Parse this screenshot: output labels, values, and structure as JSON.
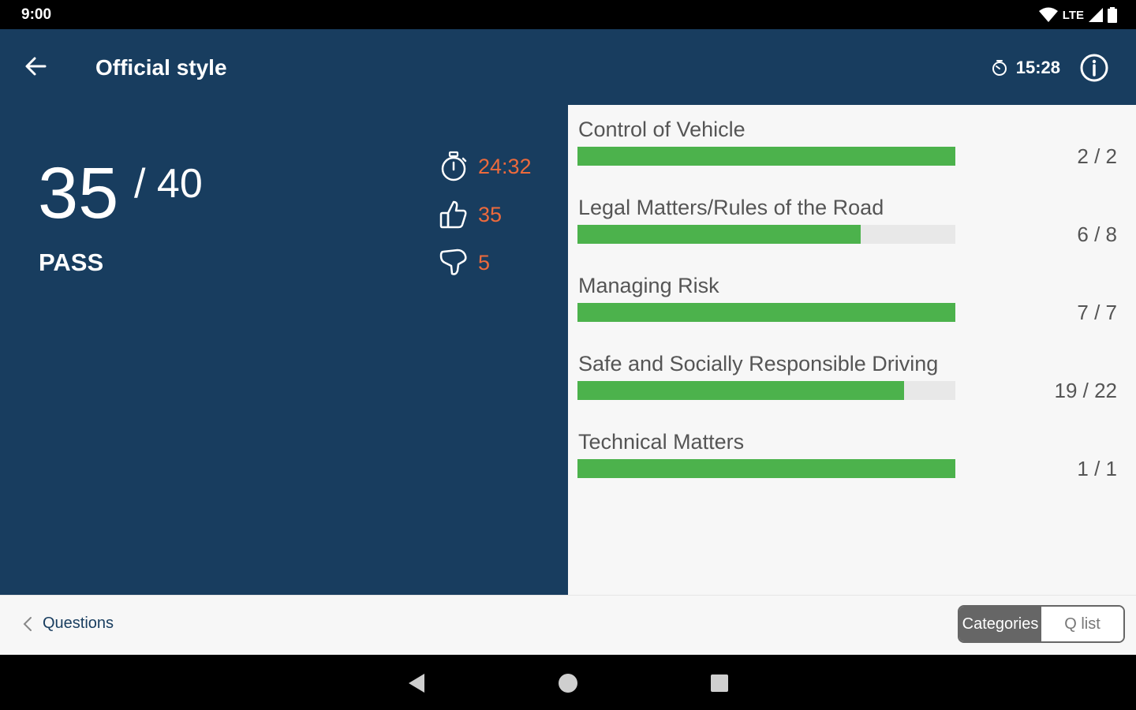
{
  "status_bar": {
    "time": "9:00",
    "network": "LTE"
  },
  "app_bar": {
    "title": "Official style",
    "timer": "15:28"
  },
  "score": {
    "correct": "35",
    "total": "/ 40",
    "result": "PASS",
    "time_taken": "24:32",
    "right_count": "35",
    "wrong_count": "5",
    "accent_color": "#ec6a3c"
  },
  "categories": [
    {
      "name": "Control of Vehicle",
      "score": "2 / 2",
      "progress": 1.0
    },
    {
      "name": "Legal Matters/Rules of the Road",
      "score": "6 / 8",
      "progress": 0.75
    },
    {
      "name": "Managing Risk",
      "score": "7 / 7",
      "progress": 1.0
    },
    {
      "name": "Safe and Socially Responsible Driving",
      "score": "19 / 22",
      "progress": 0.8636
    },
    {
      "name": "Technical Matters",
      "score": "1 / 1",
      "progress": 1.0
    }
  ],
  "bottom_bar": {
    "questions_label": "Questions",
    "toggle": {
      "categories_label": "Categories",
      "qlist_label": "Q list"
    }
  },
  "colors": {
    "primary": "#183d5f",
    "progress": "#4cb24c",
    "track": "#e8e8e8"
  },
  "icons": {
    "back": "arrow-left-icon",
    "timer": "timer-icon",
    "info": "info-icon",
    "stopwatch": "stopwatch-icon",
    "thumbs_up": "thumbs-up-icon",
    "thumbs_down": "thumbs-down-icon",
    "chevron": "chevron-left-icon",
    "wifi": "wifi-icon",
    "signal": "signal-icon",
    "battery": "battery-icon"
  }
}
